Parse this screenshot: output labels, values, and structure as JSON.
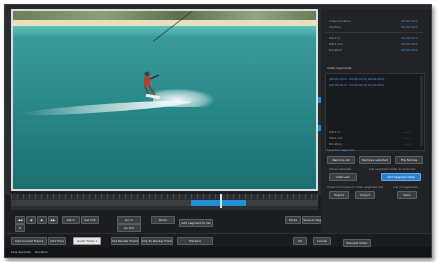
{
  "controls": {
    "transport": [
      "◀◀",
      "◀",
      "▶",
      "▶▶",
      "⏹"
    ],
    "in_label": "Set In",
    "out_label": "Set Out",
    "go_in_label": "Go In",
    "go_out_label": "Go Out",
    "add_segment_label": "Add segment to list",
    "mode_label": "Mode",
    "save_label": "Save to Segments"
  },
  "bottom": {
    "btn1": "Add Current Frame",
    "btn2": "Add Time",
    "select": "Audio Track 1",
    "btn3": "Set Render Frame",
    "btn4": "Clip To Render Frame",
    "btn5": "Markers",
    "ok": "OK",
    "cancel": "Cancel",
    "preview": "Preview Video"
  },
  "status": {
    "left": "Line Seconds",
    "mid": "Duration"
  },
  "panel": {
    "info": [
      {
        "label": "Video duration",
        "value": "00:00:02:0"
      },
      {
        "label": "Position",
        "value": "00:00:02:0"
      },
      {
        "label": "Mark in",
        "value": "00:00:01:0"
      },
      {
        "label": "Mark out",
        "value": "00:00:02:0"
      },
      {
        "label": "Duration",
        "value": "00:00:00:0"
      }
    ],
    "segments_title": "Video Segments",
    "segments": [
      "[00:00:00:0 - 00:00:01:0] 00:00:00:0",
      "[00:00:01:0 - 00:00:02:0] 00:00:00:0"
    ],
    "totals": [
      {
        "label": "Mark in",
        "value": "-- -- --"
      },
      {
        "label": "Mark out",
        "value": "-- -- --"
      },
      {
        "label": "Duration",
        "value": "-- -- --"
      }
    ],
    "selected_label": "Selected segment",
    "remove_label": "Remove All",
    "remove_selected_label": "Remove selected",
    "move_label": "File Names",
    "show_intervals": "Show intervals",
    "join_label": "Join segment slider to intervals",
    "intervals_btn": "Intervals",
    "add_all_btn": "Add Segment Now",
    "import_label": "Import and export video segment list",
    "list_label": "List of segments",
    "export_btn": "Export",
    "import_btn": "Import",
    "save_btn": "Save"
  }
}
